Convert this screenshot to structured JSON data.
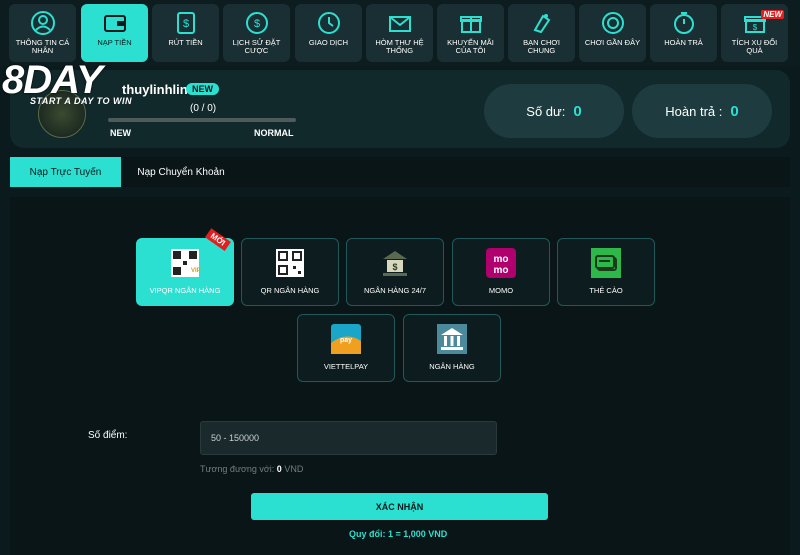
{
  "nav": {
    "items": [
      {
        "label": "THÔNG TIN CÁ NHÂN",
        "icon": "user-icon"
      },
      {
        "label": "NẠP TIỀN",
        "icon": "wallet-icon",
        "active": true
      },
      {
        "label": "RÚT TIỀN",
        "icon": "withdraw-icon"
      },
      {
        "label": "LỊCH SỬ ĐẶT CƯỢC",
        "icon": "bet-history-icon"
      },
      {
        "label": "GIAO DỊCH",
        "icon": "clock-history-icon"
      },
      {
        "label": "HÒM THƯ HỆ THỐNG",
        "icon": "mail-icon"
      },
      {
        "label": "KHUYẾN MÃI CỦA TÔI",
        "icon": "gift-icon"
      },
      {
        "label": "BẠN CHƠI CHUNG",
        "icon": "friends-icon"
      },
      {
        "label": "CHƠI GẦN ĐÂY",
        "icon": "chip-icon"
      },
      {
        "label": "HOÀN TRẢ",
        "icon": "stopwatch-icon"
      },
      {
        "label": "TÍCH XU ĐỔI QUÀ",
        "icon": "gift-box-icon",
        "tag": "NEW"
      }
    ]
  },
  "logo": {
    "text": "8DAY",
    "tagline": "START A DAY TO WIN"
  },
  "profile": {
    "username": "thuylinhlink",
    "badge": "NEW",
    "progress_text": "(0 / 0)",
    "progress_fraction": 0,
    "level_from": "NEW",
    "level_to": "NORMAL",
    "balance_label": "Số dư:",
    "balance_value": "0",
    "rebate_label": "Hoàn trả :",
    "rebate_value": "0"
  },
  "tabs": [
    {
      "label": "Nạp Trực Tuyến",
      "active": true
    },
    {
      "label": "Nạp Chuyển Khoản",
      "active": false
    }
  ],
  "methods": [
    {
      "label": "VIPQR NGÂN HÀNG",
      "icon": "vipqr-icon",
      "tag": "MỚI",
      "active": true
    },
    {
      "label": "QR NGÂN HÀNG",
      "icon": "qr-code-icon"
    },
    {
      "label": "NGÂN HÀNG 24/7",
      "icon": "bank-247-icon"
    },
    {
      "label": "MOMO",
      "icon": "momo-icon"
    },
    {
      "label": "THẺ CÀO",
      "icon": "scratch-card-icon"
    },
    {
      "label": "VIETTELPAY",
      "icon": "viettelpay-icon"
    },
    {
      "label": "NGÂN HÀNG",
      "icon": "bank-icon"
    }
  ],
  "form": {
    "amount_label": "Số điểm:",
    "amount_placeholder": "50 - 150000",
    "equiv_prefix": "Tương đương với:",
    "equiv_value": "0",
    "equiv_unit": "VND",
    "confirm_label": "XÁC NHẬN",
    "rate_text": "Quy đổi: 1 = 1,000 VND"
  },
  "colors": {
    "accent": "#2be0d0",
    "background": "#0b1a1c",
    "tag_red": "#e02020"
  }
}
